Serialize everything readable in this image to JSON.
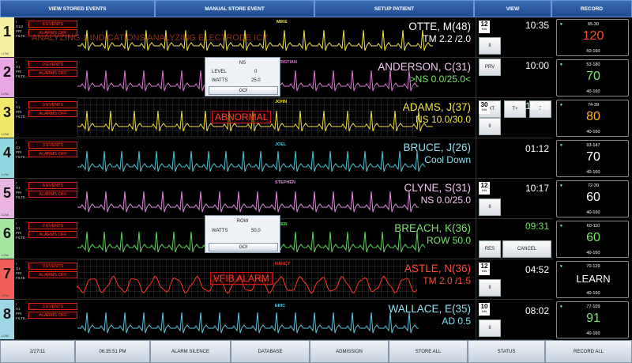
{
  "top_menu": [
    {
      "label": "VIEW STORED EVENTS"
    },
    {
      "label": "MANUAL STORE EVENT"
    },
    {
      "label": "SETUP PATIENT"
    },
    {
      "label": "VIEW"
    },
    {
      "label": "RECORD"
    }
  ],
  "bottom_menu": [
    {
      "label": "2/27/11"
    },
    {
      "label": "06:35:51 PM"
    },
    {
      "label": "ALARM SILENCE"
    },
    {
      "label": "DATABASE"
    },
    {
      "label": "ADMISSION"
    },
    {
      "label": "STORE ALL"
    },
    {
      "label": "STATUS"
    },
    {
      "label": "RECORD ALL"
    }
  ],
  "channels": [
    {
      "number": "1",
      "color": "#f6efa0",
      "low": "LOW"
    },
    {
      "number": "2",
      "color": "#e7a6e6",
      "low": "LOW"
    },
    {
      "number": "3",
      "color": "#f2e86a",
      "low": "LOW"
    },
    {
      "number": "4",
      "color": "#8fd6de",
      "low": "LOW"
    },
    {
      "number": "5",
      "color": "#eab4e2",
      "low": "LOW"
    },
    {
      "number": "6",
      "color": "#a6e6a0",
      "low": "LOW"
    },
    {
      "number": "7",
      "color": "#f06058",
      "low": "LOW"
    },
    {
      "number": "8",
      "color": "#9fd6e6",
      "low": "LOW"
    }
  ],
  "rows": [
    {
      "modes": [
        "I",
        "X1/2",
        "PRI",
        "FILTE"
      ],
      "events": "8 EVENTS",
      "alarms": "ALARMS OFF",
      "tag": "MIKE",
      "name": "OTTE, M(48)",
      "status": "TM 2.2 /2.0",
      "color": "#f3e845",
      "name_color": "#ffffff",
      "status_color": "#ffffff",
      "ghost": "ANALYZING 1 INDICATIONS ANALYZING ELECTRODE ICY"
    },
    {
      "modes": [
        "I",
        "X1",
        "PRI",
        "FILTE"
      ],
      "events": "0 EVENTS",
      "alarms": "ALARMS OFF",
      "tag": "RISTIAN",
      "name": "ANDERSON, C(31)",
      "status": ">NS 0.0/25.0<",
      "color": "#e07ad8",
      "name_color": "#f3c8ef",
      "status_color": "#7de46a"
    },
    {
      "modes": [
        "I",
        "X1",
        "PRI",
        "FILTE"
      ],
      "events": "9 EVENTS",
      "alarms": "ALARMS OFF",
      "tag": "JOHN",
      "name": "ADAMS, J(37)",
      "status": "NS 10.0/30.0",
      "color": "#f0e033",
      "name_color": "#f3e845",
      "status_color": "#f3e845",
      "alarm": "ABNORMAL"
    },
    {
      "modes": [
        "I",
        "X1",
        "PRI",
        "FILTE"
      ],
      "events": "3 EVENTS",
      "alarms": "ALARMS OFF",
      "tag": "JOEL",
      "name": "BRUCE, J(26)",
      "status": "Cool Down",
      "color": "#46c8d8",
      "name_color": "#8fe2ee",
      "status_color": "#8fe2ee"
    },
    {
      "modes": [
        "I",
        "X1",
        "PRI",
        "FILTE"
      ],
      "events": "6 EVENTS",
      "alarms": "ALARMS OFF",
      "tag": "STEPHEN",
      "name": "CLYNE, S(31)",
      "status": "NS 0.0/25.0",
      "color": "#e590e0",
      "name_color": "#f3c8ef",
      "status_color": "#f3c8ef"
    },
    {
      "modes": [
        "I",
        "X1",
        "PRI",
        "FILTE"
      ],
      "events": "2 EVENTS",
      "alarms": "ALARMS OFF",
      "tag": "REN",
      "name": "BREACH, K(36)",
      "status": "ROW 50.0",
      "color": "#58d858",
      "name_color": "#7de46a",
      "status_color": "#7de46a"
    },
    {
      "modes": [
        "I",
        "X1",
        "PRI",
        "FILTE"
      ],
      "events": "9 EVENTS",
      "alarms": "ALARMS OFF",
      "tag": "NANCY",
      "name": "ASTLE, N(36)",
      "status": "TM 2.0 /1.5",
      "color": "#ff3426",
      "name_color": "#ff4a3a",
      "status_color": "#ff4a3a",
      "alarm": "VFIB ALARM"
    },
    {
      "modes": [
        "I",
        "X1",
        "PRI",
        "FILTE"
      ],
      "events": "3 EVENTS",
      "alarms": "ALARMS OFF",
      "tag": "ERIC",
      "name": "WALLACE, E(35)",
      "status": "AD 0.5",
      "color": "#5cc8e0",
      "name_color": "#8fe2ee",
      "status_color": "#8fe2ee"
    }
  ],
  "popups": {
    "ns": {
      "title": "NS",
      "level_label": "LEVEL",
      "level_value": "0",
      "watts_label": "WATTS",
      "watts_value": "25.0",
      "go": "GO!"
    },
    "row": {
      "title": "ROW",
      "watts_label": "WATTS",
      "watts_value": "50.0",
      "go": "GO!"
    }
  },
  "view": {
    "rows": [
      {
        "box_num": "12",
        "box_unit": "MIN",
        "time": "10:35",
        "button": "II"
      },
      {
        "time": "10:00",
        "buttons": [
          "PRV",
          "NXT",
          "T+",
          "T-"
        ]
      },
      {
        "box_num": "30",
        "box_unit": "MIN",
        "time": "15:02",
        "button": "II"
      },
      {
        "time": "01:12"
      },
      {
        "box_num": "12",
        "box_unit": "MIN",
        "time": "10:17",
        "button": "II"
      },
      {
        "time": "09:31",
        "time_color": "#6fe06a",
        "buttons": [
          "RES",
          "CANCEL"
        ]
      },
      {
        "box_num": "12",
        "box_unit": "MIN",
        "time": "04:52",
        "button": "II"
      },
      {
        "box_num": "10",
        "box_unit": "MIN",
        "time": "08:02",
        "button": "II"
      }
    ]
  },
  "record": [
    {
      "range": "65-30",
      "value": "120",
      "color": "#ff4a3a",
      "limits": "50-160"
    },
    {
      "range": "53-180",
      "value": "70",
      "color": "#7de46a",
      "limits": "40-160"
    },
    {
      "range": "74-39",
      "value": "80",
      "color": "#ffb020",
      "limits": "40-160"
    },
    {
      "range": "93-147",
      "value": "70",
      "color": "#ffffff",
      "limits": "40-160"
    },
    {
      "range": "72-30",
      "value": "60",
      "color": "#ffffff",
      "limits": "40-160"
    },
    {
      "range": "60-110",
      "value": "60",
      "color": "#7de46a",
      "limits": "40-160"
    },
    {
      "range": "70-129",
      "value": "LEARN",
      "color": "#ffffff",
      "limits": "40-160"
    },
    {
      "range": "77-109",
      "value": "91",
      "color": "#7de46a",
      "limits": "40-160"
    }
  ]
}
